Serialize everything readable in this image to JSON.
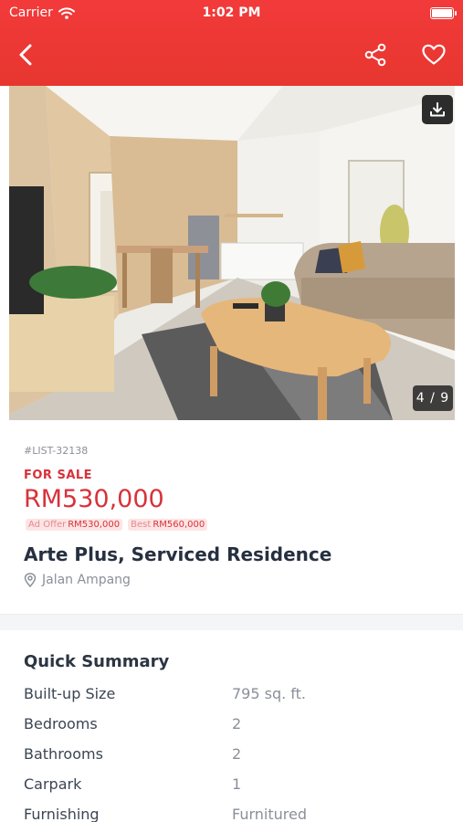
{
  "status_bar": {
    "carrier": "Carrier",
    "time": "1:02 PM"
  },
  "nav": {
    "back_icon": "chevron-left-icon",
    "share_icon": "share-icon",
    "favorite_icon": "heart-outline-icon"
  },
  "gallery": {
    "current": 4,
    "total": 9,
    "counter_text": "4 / 9",
    "download_icon": "download-icon"
  },
  "listing": {
    "id": "#LIST-32138",
    "sale_label": "FOR SALE",
    "price": "RM530,000",
    "offers": [
      {
        "label": "Ad Offer",
        "value": "RM530,000"
      },
      {
        "label": "Best",
        "value": "RM560,000"
      }
    ],
    "title": "Arte Plus, Serviced Residence",
    "location": "Jalan Ampang"
  },
  "summary": {
    "title": "Quick Summary",
    "rows": [
      {
        "label": "Built-up Size",
        "value": "795 sq. ft."
      },
      {
        "label": "Bedrooms",
        "value": "2"
      },
      {
        "label": "Bathrooms",
        "value": "2"
      },
      {
        "label": "Carpark",
        "value": "1"
      },
      {
        "label": "Furnishing",
        "value": "Furnitured"
      }
    ]
  },
  "colors": {
    "accent_red": "#e7362f",
    "price_red": "#d8323a",
    "text_dark": "#263040",
    "text_muted": "#8a9099"
  }
}
